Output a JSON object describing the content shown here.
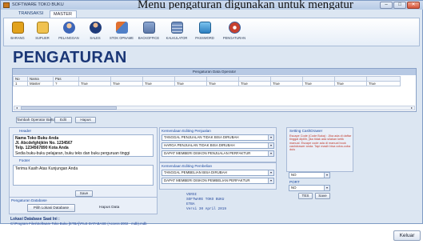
{
  "caption": "Menu pengaturan digunakan untuk mengatur",
  "window": {
    "title": "SOFTWARE TOKO BUKU",
    "controls": {
      "minimize": "–",
      "maximize": "□",
      "close": "✕"
    }
  },
  "tabs": [
    {
      "label": "TRANSAKSI",
      "active": false
    },
    {
      "label": "MASTER",
      "active": true
    }
  ],
  "ribbon": {
    "items": [
      {
        "label": "BARANG",
        "icon": "folder-icon",
        "color": "#e2a21c"
      },
      {
        "label": "SUPLIER",
        "icon": "folder-open-icon",
        "color": "#e9b43a"
      },
      {
        "label": "PELANGGAN",
        "icon": "customer-icon",
        "color": "#3d66b8"
      },
      {
        "label": "SALES",
        "icon": "sales-person-icon",
        "color": "#1f3b7a"
      },
      {
        "label": "STOK OPNAME",
        "icon": "stock-icon",
        "color": "#4f7fc7"
      },
      {
        "label": "BACKOFFICE",
        "icon": "backoffice-icon",
        "color": "#6d88b8"
      },
      {
        "label": "KALKULATOR",
        "icon": "calculator-icon",
        "color": "#5b79a8"
      },
      {
        "label": "PASSWORD",
        "icon": "password-icon",
        "color": "#3d9adb"
      },
      {
        "label": "PENGATURAN",
        "icon": "settings-icon",
        "color": "#c6402f"
      }
    ]
  },
  "page_title": "PENGATURAN",
  "operator_grid": {
    "title": "Pengaturan Data Operator",
    "columns": [
      "No",
      "Nama",
      "Pas",
      "",
      "",
      "",
      "",
      "",
      "",
      "",
      "",
      "",
      ""
    ],
    "rows": [
      [
        "1",
        "Master",
        "?",
        "True",
        "True",
        "True",
        "True",
        "True",
        "True",
        "True",
        "True",
        "True",
        "True"
      ]
    ]
  },
  "operator_buttons": {
    "add": "Tambah Operator Baru",
    "edit": "Edit",
    "delete": "Hapus"
  },
  "header_panel": {
    "title": "Header",
    "lines": [
      "Nama Toko Buku Anda",
      "Jl. Abcdefghijklm No. 1234567",
      "Telp. 1234567890 Kota Anda",
      "Sedia buku-buku pelajaran, buku teks dan buku perguruan tinggi"
    ],
    "footer_label": "Footer",
    "footer_text": "Terima Kasih Atas Kunjungan Anda",
    "save": "Save"
  },
  "db_panel": {
    "title": "Pengaturan Database",
    "choose": "Pilih Lokasi Database",
    "delete": "Hapus Data"
  },
  "edit_jual": {
    "title": "Kemendaan Editing Penjualan",
    "options": [
      "TANGGAL PENJUALAN TIDAK BISA DIRUBAH",
      "HARGA PENJUALAN TIDAK BISA DIRUBAH",
      "DAPAT MEMBERI DISKON PENJUALAN PERFAKTUR"
    ]
  },
  "edit_beli": {
    "title": "Kemendaan Editing Pembelian",
    "options": [
      "TANGGAL PEMBELIAN BISA DIRUBAH",
      "DAPAT MEMBERI DISKON PEMBELIAN PERFAKTUR"
    ]
  },
  "cash_drawer": {
    "title": "Setting CashDrawer",
    "note": "Escape Code (Code Buka) : Jika ada di daftar tinggal dipilih, jika tidak ada silakan ketik manual. Escape code ada di manual book cashdrawer anda. Tapi masih bisa coba-coba dulu",
    "code_value": "NO",
    "port_label": "PORT",
    "port_value": "NO",
    "tes": "TES",
    "save": "Save"
  },
  "version": {
    "label": "VERSI",
    "name": "SOFTWARE TOKO BUKU",
    "edition": "ETBA",
    "date": "Versi 30 April 2019"
  },
  "db_location": {
    "label": "Lokasi Database Saat Ini :",
    "path": "C:\\Program Files\\Software Toko Buku [ETBA]\\FILE DATABASE (Access 2002 - mdb).mdb"
  },
  "exit_button": "Keluar"
}
